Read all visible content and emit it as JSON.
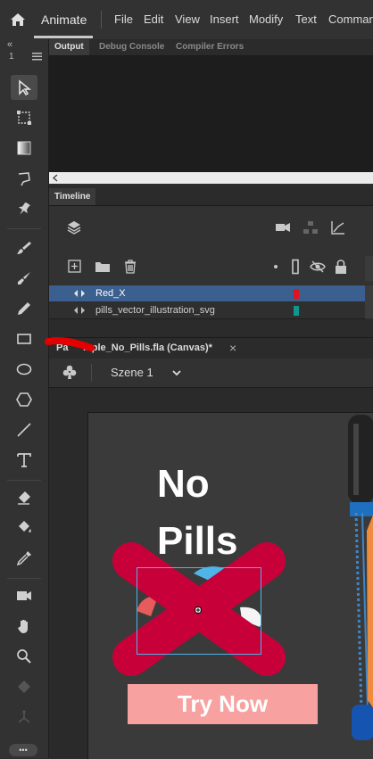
{
  "menubar": {
    "app_name": "Animate",
    "items": [
      "File",
      "Edit",
      "View",
      "Insert",
      "Modify",
      "Text",
      "Command"
    ]
  },
  "toolbar": {
    "collapse_label": "«",
    "column_indicator": "1",
    "tools": [
      "selection-tool",
      "free-transform-tool",
      "gradient-tool",
      "lasso-tool",
      "pin-tool",
      "paint-brush-tool",
      "brush-tool",
      "pencil-tool",
      "rectangle-tool",
      "oval-tool",
      "polystar-tool",
      "line-tool",
      "text-tool",
      "eraser-tool",
      "paint-bucket-tool",
      "eyedropper-tool",
      "camera-tool",
      "hand-tool",
      "zoom-tool",
      "asset-warp-tool",
      "bone-tool"
    ],
    "more_label": "•••"
  },
  "output_panel": {
    "tabs": [
      "Output",
      "Debug Console",
      "Compiler Errors"
    ],
    "active_tab": "Output"
  },
  "timeline": {
    "tab_label": "Timeline",
    "layers": [
      {
        "name": "Red_X",
        "color": "#e0141e",
        "selected": true
      },
      {
        "name": "pills_vector_illustration_svg",
        "color": "#10968f",
        "selected": false
      }
    ]
  },
  "document": {
    "tab_label": "mple_No_Pills.fla (Canvas)*",
    "tab_prefix": "Pa",
    "close_label": "×",
    "scene_label": "Szene 1"
  },
  "stage": {
    "headline_line1": "No",
    "headline_line2": "Pills",
    "cta_label": "Try Now",
    "x_color": "#c8003a",
    "cta_color": "#f7a1a0",
    "selection_color": "#4fb4e8"
  },
  "annotation": {
    "scribble_color": "#e30000"
  }
}
